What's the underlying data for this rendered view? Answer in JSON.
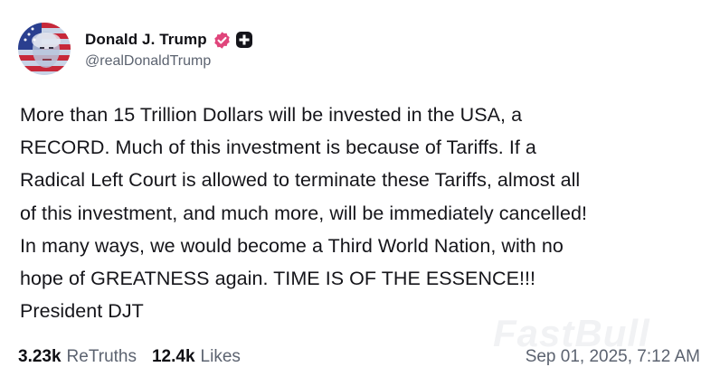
{
  "author": {
    "display_name": "Donald J. Trump",
    "handle": "@realDonaldTrump",
    "verified_icon": "verified-badge-icon",
    "badge_icon": "plus-badge-icon",
    "verified_color": "#e0457b"
  },
  "post": {
    "text": "More than 15 Trillion Dollars will be invested in the USA, a\nRECORD. Much of this investment is because of Tariffs. If a\nRadical Left Court is allowed to terminate these Tariffs, almost all\nof this investment, and much more, will be immediately cancelled!\nIn many ways, we would become a Third World Nation, with no\nhope of GREATNESS again. TIME IS OF THE ESSENCE!!!\nPresident DJT"
  },
  "stats": {
    "retruths_count": "3.23k",
    "retruths_label": "ReTruths",
    "likes_count": "12.4k",
    "likes_label": "Likes"
  },
  "timestamp": "Sep 01, 2025, 7:12 AM",
  "watermark": "FastBull"
}
